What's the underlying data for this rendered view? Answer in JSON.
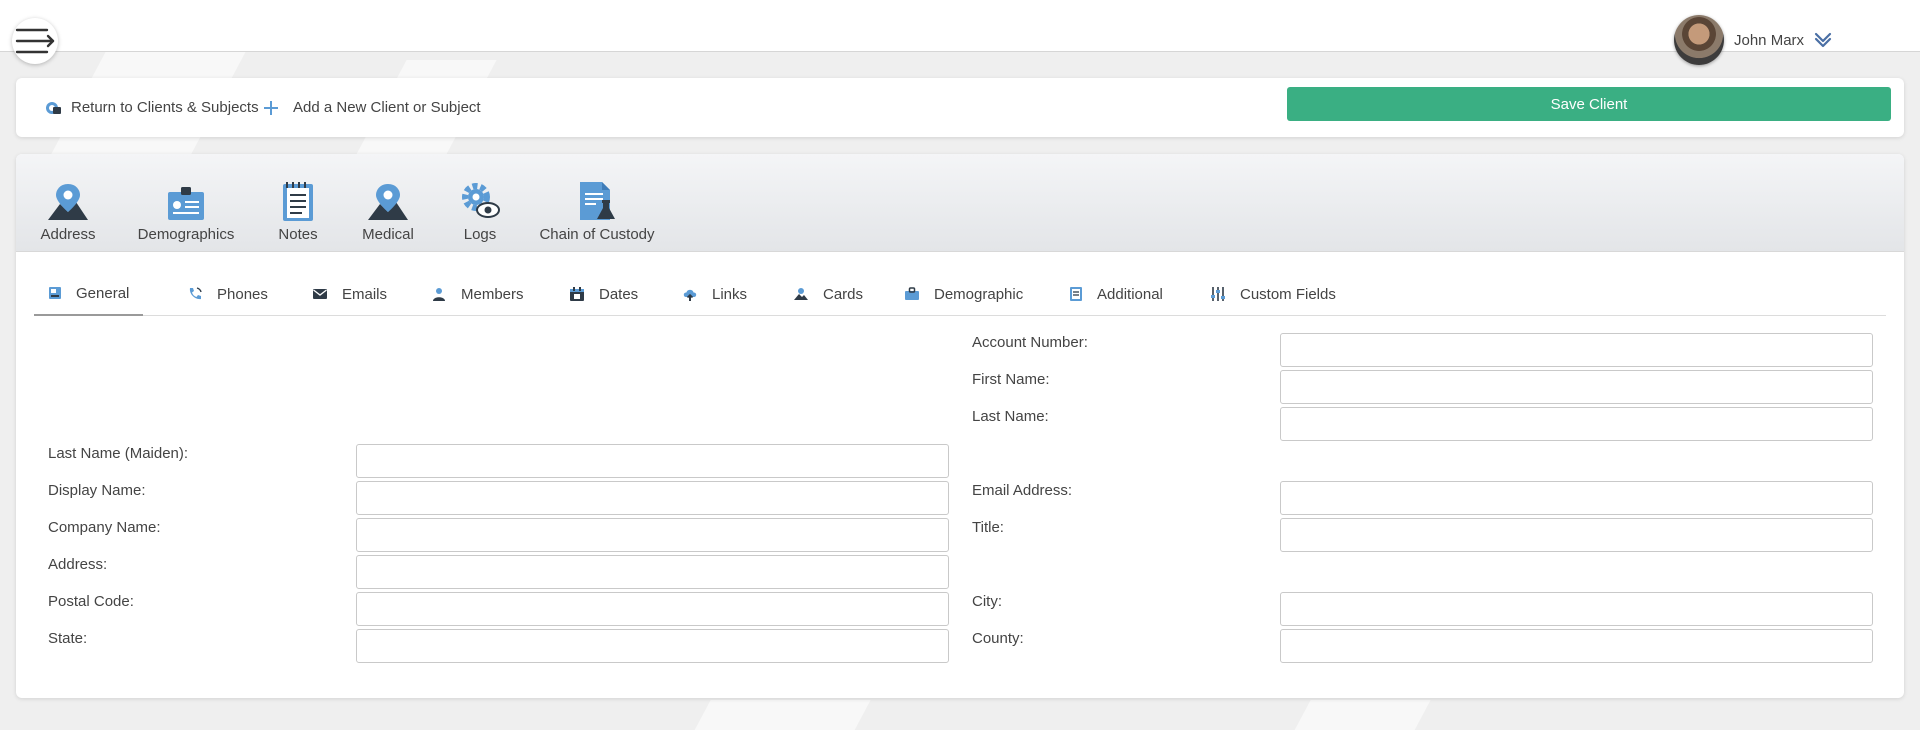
{
  "header": {
    "menu_icon": "menu-arrow-icon",
    "user_name": "John Marx",
    "user_caret_icon": "chevron-double-down-icon"
  },
  "actions": {
    "return_label": "Return to Clients & Subjects",
    "add_label": "Add a New Client or Subject",
    "save_label": "Save Client"
  },
  "modules": [
    {
      "label": "Address",
      "icon": "location-pin-icon"
    },
    {
      "label": "Demographics",
      "icon": "id-badge-icon"
    },
    {
      "label": "Notes",
      "icon": "notepad-icon"
    },
    {
      "label": "Medical",
      "icon": "location-pin-icon"
    },
    {
      "label": "Logs",
      "icon": "gear-eye-icon"
    },
    {
      "label": "Chain of Custody",
      "icon": "document-flask-icon"
    }
  ],
  "tabs": [
    {
      "label": "General",
      "icon": "form-icon",
      "active": true
    },
    {
      "label": "Phones",
      "icon": "phone-icon"
    },
    {
      "label": "Emails",
      "icon": "envelope-icon"
    },
    {
      "label": "Members",
      "icon": "members-icon"
    },
    {
      "label": "Dates",
      "icon": "calendar-icon"
    },
    {
      "label": "Links",
      "icon": "cloud-link-icon"
    },
    {
      "label": "Cards",
      "icon": "card-icon"
    },
    {
      "label": "Demographic",
      "icon": "briefcase-icon"
    },
    {
      "label": "Additional",
      "icon": "notebook-icon"
    },
    {
      "label": "Custom Fields",
      "icon": "sliders-icon"
    }
  ],
  "form": {
    "account_number": {
      "label": "Account Number:",
      "value": ""
    },
    "first_name": {
      "label": "First Name:",
      "value": ""
    },
    "last_name": {
      "label": "Last Name:",
      "value": ""
    },
    "last_name_maiden": {
      "label": "Last Name (Maiden):",
      "value": ""
    },
    "display_name": {
      "label": "Display Name:",
      "value": ""
    },
    "company_name": {
      "label": "Company Name:",
      "value": ""
    },
    "address": {
      "label": "Address:",
      "value": ""
    },
    "postal_code": {
      "label": "Postal Code:",
      "value": ""
    },
    "state": {
      "label": "State:",
      "value": ""
    },
    "email_address": {
      "label": "Email Address:",
      "value": ""
    },
    "title": {
      "label": "Title:",
      "value": ""
    },
    "city": {
      "label": "City:",
      "value": ""
    },
    "county": {
      "label": "County:",
      "value": ""
    }
  },
  "colors": {
    "accent_green": "#3aaf83",
    "icon_blue": "#5b9bd5",
    "icon_dark": "#2f3b47"
  }
}
